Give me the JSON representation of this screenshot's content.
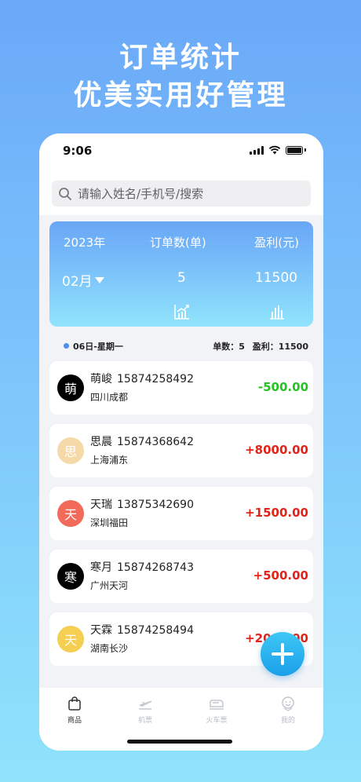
{
  "promo": {
    "line1": "订单统计",
    "line2": "优美实用好管理"
  },
  "status_bar": {
    "time": "9:06"
  },
  "search": {
    "placeholder": "请输入姓名/手机号/搜索"
  },
  "summary": {
    "year_label": "2023年",
    "orders_label": "订单数(单)",
    "profit_label": "盈利(元)",
    "month": "02月",
    "orders_value": "5",
    "profit_value": "11500"
  },
  "day_header": {
    "date": "06日-星期一",
    "orders": "单数：5",
    "profit": "盈利：11500"
  },
  "orders": [
    {
      "avatar": "萌",
      "avatar_color": "#000000",
      "name": "萌峻",
      "phone": "15874258492",
      "city": "四川成都",
      "amount": "-500.00",
      "amount_color": "#22c322"
    },
    {
      "avatar": "思",
      "avatar_color": "#f5d9a8",
      "name": "思晨",
      "phone": "15874368642",
      "city": "上海浦东",
      "amount": "+8000.00",
      "amount_color": "#e2231a"
    },
    {
      "avatar": "天",
      "avatar_color": "#f26a5a",
      "name": "天瑞",
      "phone": "13875342690",
      "city": "深圳福田",
      "amount": "+1500.00",
      "amount_color": "#e2231a"
    },
    {
      "avatar": "寒",
      "avatar_color": "#000000",
      "name": "寒月",
      "phone": "15874268743",
      "city": "广州天河",
      "amount": "+500.00",
      "amount_color": "#e2231a"
    },
    {
      "avatar": "天",
      "avatar_color": "#f5cf52",
      "name": "天霖",
      "phone": "15874258494",
      "city": "湖南长沙",
      "amount": "+2000.00",
      "amount_color": "#e2231a"
    }
  ],
  "tabs": [
    {
      "label": "商品",
      "icon": "shopping-bag-icon",
      "active": true
    },
    {
      "label": "机票",
      "icon": "plane-ticket-icon",
      "active": false
    },
    {
      "label": "火车票",
      "icon": "train-icon",
      "active": false
    },
    {
      "label": "我的",
      "icon": "profile-icon",
      "active": false
    }
  ],
  "colors": {
    "accent": "#4a8ef0",
    "positive": "#e2231a",
    "negative": "#22c322"
  }
}
